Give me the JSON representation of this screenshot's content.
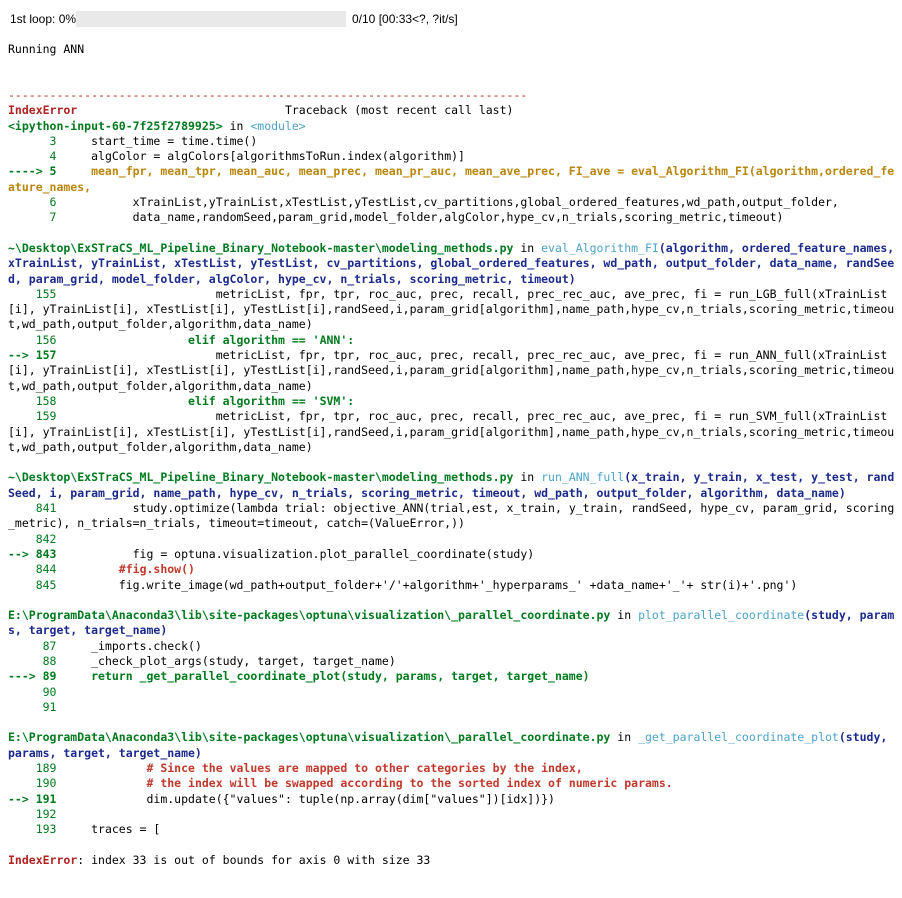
{
  "progress": {
    "description": "1st loop: 0%",
    "fraction": 0.0,
    "status": "0/10 [00:33<?, ?it/s]",
    "fill_color": "#4a90d9"
  },
  "stdout": "Running ANN",
  "traceback": {
    "rule": "---------------------------------------------------------------------------",
    "error_name": "IndexError",
    "header_right": "                              Traceback (most recent call last)",
    "input_ref": "<ipython-input-60-7f25f2789925>",
    "in_word": " in ",
    "module": "<module>",
    "frame1": [
      {
        "num": "      3 ",
        "arrow": "",
        "code": "    start_time = time.time()",
        "hl": false
      },
      {
        "num": "      4 ",
        "arrow": "",
        "code": "    algColor = algColors[algorithmsToRun.index(algorithm)]",
        "hl": false
      },
      {
        "num": "",
        "arrow": "----> 5 ",
        "code": "    mean_fpr, mean_tpr, mean_auc, mean_prec, mean_pr_auc, mean_ave_prec, FI_ave = eval_Algorithm_FI(algorithm,ordered_feature_names,",
        "hl": true
      },
      {
        "num": "      6 ",
        "arrow": "",
        "code": "          xTrainList,yTrainList,xTestList,yTestList,cv_partitions,global_ordered_features,wd_path,output_folder,",
        "hl": false
      },
      {
        "num": "      7 ",
        "arrow": "",
        "code": "          data_name,randomSeed,param_grid,model_folder,algColor,hype_cv,n_trials,scoring_metric,timeout)",
        "hl": false
      }
    ],
    "frame2_path": "~\\Desktop\\ExSTraCS_ML_Pipeline_Binary_Notebook-master\\modeling_methods.py",
    "frame2_func": "eval_Algorithm_FI",
    "frame2_args": "(algorithm, ordered_feature_names, xTrainList, yTrainList, xTestList, yTestList, cv_partitions, global_ordered_features, wd_path, output_folder, data_name, randSeed, param_grid, model_folder, algColor, hype_cv, n_trials, scoring_metric, timeout)",
    "frame2": [
      {
        "num": "    155 ",
        "arrow": "",
        "code": "                      metricList, fpr, tpr, roc_auc, prec, recall, prec_rec_auc, ave_prec, fi = run_LGB_full(xTrainList[i], yTrainList[i], xTestList[i], yTestList[i],randSeed,i,param_grid[algorithm],name_path,hype_cv,n_trials,scoring_metric,timeout,wd_path,output_folder,algorithm,data_name)",
        "hl": false
      },
      {
        "num": "    156 ",
        "arrow": "",
        "code": "                  elif algorithm == 'ANN':",
        "hl": false
      },
      {
        "num": "",
        "arrow": "--> 157 ",
        "code": "                      metricList, fpr, tpr, roc_auc, prec, recall, prec_rec_auc, ave_prec, fi = run_ANN_full(xTrainList[i], yTrainList[i], xTestList[i], yTestList[i],randSeed,i,param_grid[algorithm],name_path,hype_cv,n_trials,scoring_metric,timeout,wd_path,output_folder,algorithm,data_name)",
        "hl": true
      },
      {
        "num": "    158 ",
        "arrow": "",
        "code": "                  elif algorithm == 'SVM':",
        "hl": false
      },
      {
        "num": "    159 ",
        "arrow": "",
        "code": "                      metricList, fpr, tpr, roc_auc, prec, recall, prec_rec_auc, ave_prec, fi = run_SVM_full(xTrainList[i], yTrainList[i], xTestList[i], yTestList[i],randSeed,i,param_grid[algorithm],name_path,hype_cv,n_trials,scoring_metric,timeout,wd_path,output_folder,algorithm,data_name)",
        "hl": false
      }
    ],
    "frame3_path": "~\\Desktop\\ExSTraCS_ML_Pipeline_Binary_Notebook-master\\modeling_methods.py",
    "frame3_func": "run_ANN_full",
    "frame3_args": "(x_train, y_train, x_test, y_test, randSeed, i, param_grid, name_path, hype_cv, n_trials, scoring_metric, timeout, wd_path, output_folder, algorithm, data_name)",
    "frame3": [
      {
        "num": "    841 ",
        "arrow": "",
        "code": "          study.optimize(lambda trial: objective_ANN(trial,est, x_train, y_train, randSeed, hype_cv, param_grid, scoring_metric), n_trials=n_trials, timeout=timeout, catch=(ValueError,))",
        "hl": false
      },
      {
        "num": "    842 ",
        "arrow": "",
        "code": "",
        "hl": false
      },
      {
        "num": "",
        "arrow": "--> 843 ",
        "code": "          fig = optuna.visualization.plot_parallel_coordinate(study)",
        "hl": true
      },
      {
        "num": "    844 ",
        "arrow": "",
        "code": "        #fig.show()",
        "hl": false
      },
      {
        "num": "    845 ",
        "arrow": "",
        "code": "        fig.write_image(wd_path+output_folder+'/'+algorithm+'_hyperparams_' +data_name+'_'+ str(i)+'.png')",
        "hl": false
      }
    ],
    "frame4_path": "E:\\ProgramData\\Anaconda3\\lib\\site-packages\\optuna\\visualization\\_parallel_coordinate.py",
    "frame4_func": "plot_parallel_coordinate",
    "frame4_args": "(study, params, target, target_name)",
    "frame4": [
      {
        "num": "     87 ",
        "arrow": "",
        "code": "    _imports.check()",
        "hl": false
      },
      {
        "num": "     88 ",
        "arrow": "",
        "code": "    _check_plot_args(study, target, target_name)",
        "hl": false
      },
      {
        "num": "",
        "arrow": "---> 89 ",
        "code": "    return _get_parallel_coordinate_plot(study, params, target, target_name)",
        "hl": true
      },
      {
        "num": "     90 ",
        "arrow": "",
        "code": "",
        "hl": false
      },
      {
        "num": "     91 ",
        "arrow": "",
        "code": "",
        "hl": false
      }
    ],
    "frame5_path": "E:\\ProgramData\\Anaconda3\\lib\\site-packages\\optuna\\visualization\\_parallel_coordinate.py",
    "frame5_func": "_get_parallel_coordinate_plot",
    "frame5_args": "(study, params, target, target_name)",
    "frame5": [
      {
        "num": "    189 ",
        "arrow": "",
        "code": "            # Since the values are mapped to other categories by the index,",
        "hl": false
      },
      {
        "num": "    190 ",
        "arrow": "",
        "code": "            # the index will be swapped according to the sorted index of numeric params.",
        "hl": false
      },
      {
        "num": "",
        "arrow": "--> 191 ",
        "code": "            dim.update({\"values\": tuple(np.array(dim[\"values\"])[idx])})",
        "hl": true
      },
      {
        "num": "    192 ",
        "arrow": "",
        "code": "",
        "hl": false
      },
      {
        "num": "    193 ",
        "arrow": "",
        "code": "    traces = [",
        "hl": false
      }
    ],
    "final_error_name": "IndexError",
    "final_message": ": index 33 is out of bounds for axis 0 with size 33"
  }
}
